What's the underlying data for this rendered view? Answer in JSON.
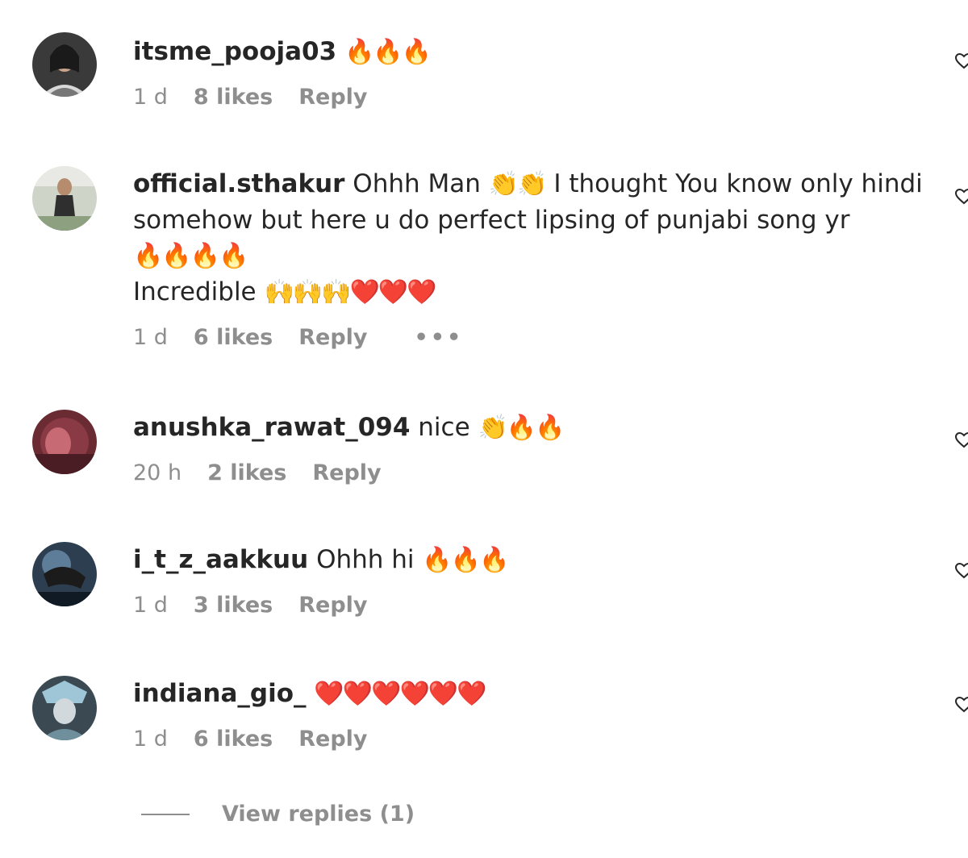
{
  "comments": [
    {
      "username": "itsme_pooja03",
      "text": "",
      "emoji": "🔥🔥🔥",
      "extra_lines": [],
      "time": "1 d",
      "likes": "8 likes",
      "reply": "Reply",
      "more": "",
      "avatar_icon": "profile-photo"
    },
    {
      "username": "official.sthakur",
      "text": "Ohhh Man",
      "emoji": "👏👏",
      "text_after": "I thought You know only hindi somehow but here u do perfect lipsing of punjabi song yr",
      "extra_lines": [
        "🔥🔥🔥🔥"
      ],
      "line3_text": "Incredible",
      "line3_emoji": "🙌🙌🙌❤️❤️❤️",
      "time": "1 d",
      "likes": "6 likes",
      "reply": "Reply",
      "more": "•••",
      "avatar_icon": "profile-photo"
    },
    {
      "username": "anushka_rawat_094",
      "text": "nice",
      "emoji": "👏🔥🔥",
      "time": "20 h",
      "likes": "2 likes",
      "reply": "Reply",
      "avatar_icon": "profile-photo"
    },
    {
      "username": "i_t_z_aakkuu",
      "text": "Ohhh hi",
      "emoji": "🔥🔥🔥",
      "time": "1 d",
      "likes": "3 likes",
      "reply": "Reply",
      "avatar_icon": "profile-photo"
    },
    {
      "username": "indiana_gio_",
      "text": "",
      "emoji": "❤️❤️❤️❤️❤️❤️",
      "time": "1 d",
      "likes": "6 likes",
      "reply": "Reply",
      "avatar_icon": "profile-photo"
    }
  ],
  "view_replies": "View replies (1)",
  "colors": {
    "text": "#262626",
    "meta": "#8e8e8e",
    "background": "#ffffff"
  }
}
